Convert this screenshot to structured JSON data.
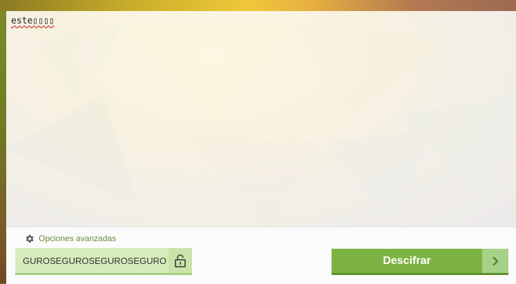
{
  "editor": {
    "text": "este▯▯▯▯"
  },
  "options": {
    "advanced_label": "Opciones avanzadas"
  },
  "password": {
    "value": "GUROSEGUROSEGUROSEGURO"
  },
  "actions": {
    "decrypt_label": "Descifrar"
  }
}
